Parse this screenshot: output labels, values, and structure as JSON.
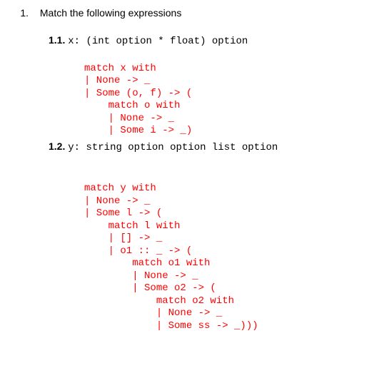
{
  "question": {
    "number": "1.",
    "title": "Match the following expressions"
  },
  "parts": [
    {
      "label": "1.1.",
      "decl_var": "x:",
      "decl_type": " (int option * float) option",
      "code": "match x with\n| None -> _\n| Some (o, f) -> (\n    match o with\n    | None -> _\n    | Some i -> _)"
    },
    {
      "label": "1.2.",
      "decl_var": "y:",
      "decl_type": " string option option list option",
      "code": "match y with\n| None -> _\n| Some l -> (\n    match l with\n    | [] -> _\n    | o1 :: _ -> (\n        match o1 with\n        | None -> _\n        | Some o2 -> (\n            match o2 with\n            | None -> _\n            | Some ss -> _)))"
    }
  ]
}
